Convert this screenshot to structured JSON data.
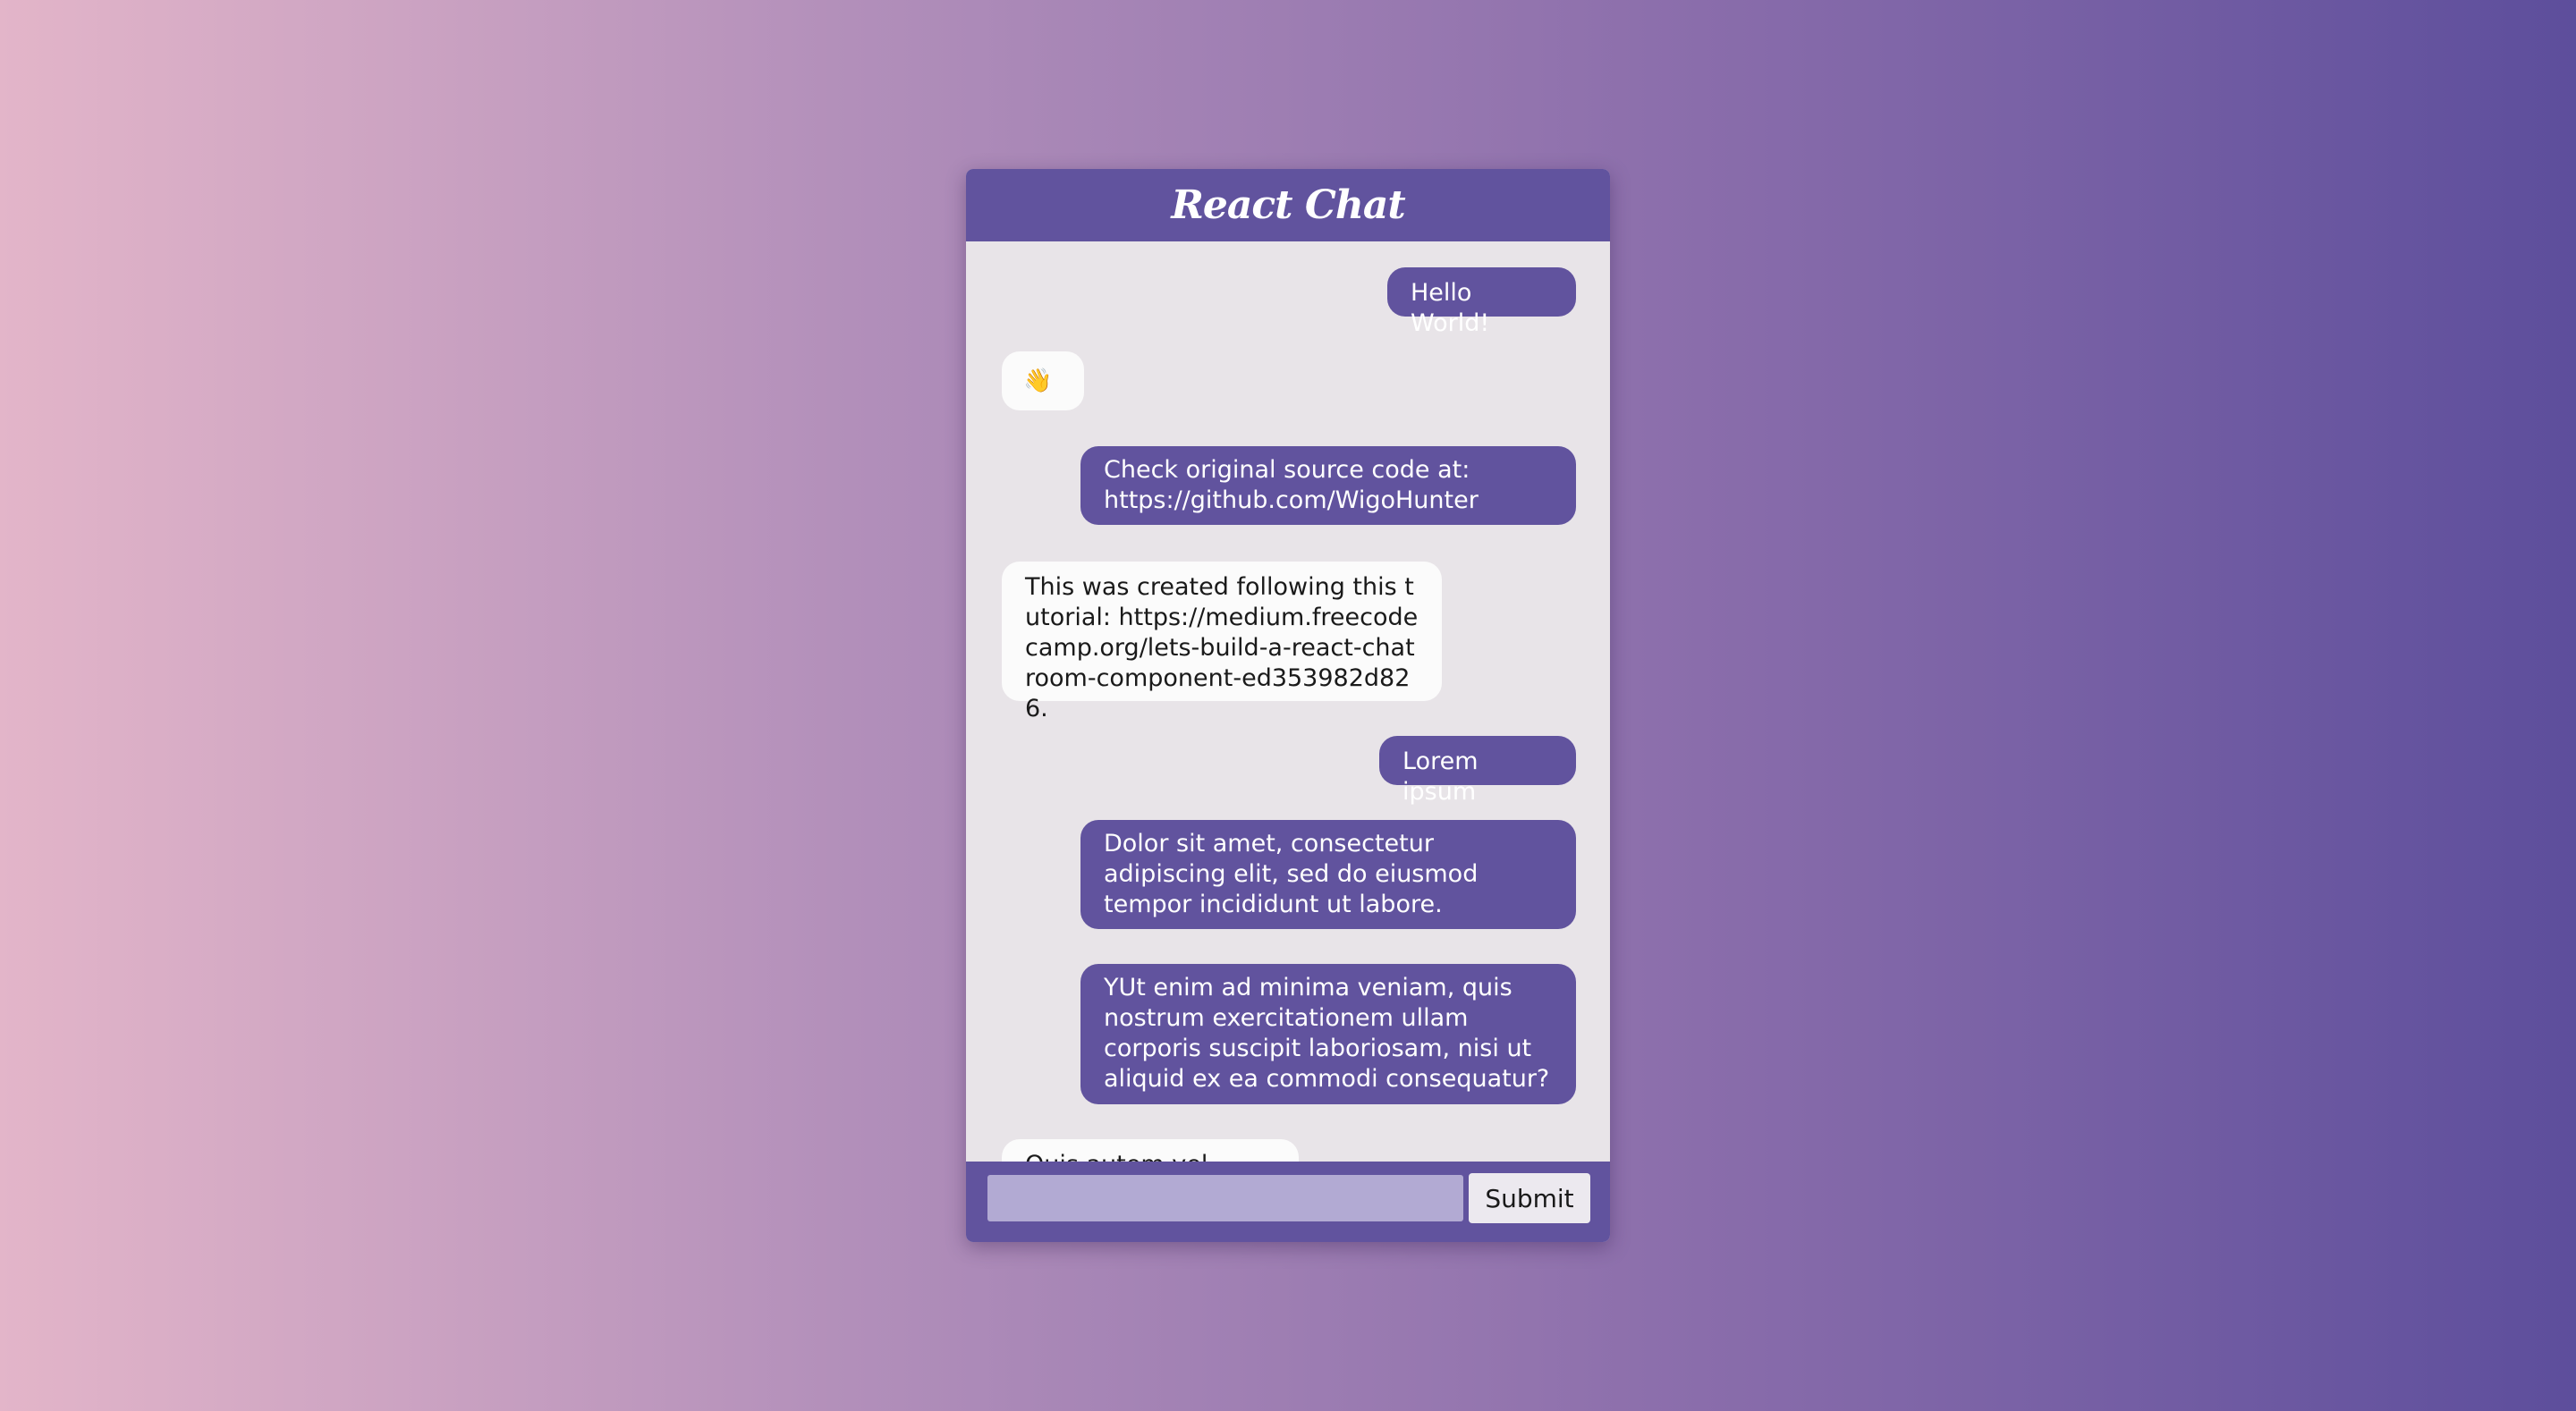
{
  "header": {
    "title": "React Chat"
  },
  "colors": {
    "header_bg": "#61539e",
    "own_bubble": "#61539e",
    "other_bubble": "#fbfbfb",
    "chat_bg": "#e8e4e8",
    "input_bg": "#b2aad3"
  },
  "messages": [
    {
      "sender": "me",
      "text": "Hello World!"
    },
    {
      "sender": "other",
      "text": "👋"
    },
    {
      "sender": "me",
      "text": "Check original source code at: https://github.com/WigoHunter"
    },
    {
      "sender": "other",
      "text": "This was created following this tutorial: https://medium.freecodecamp.org/lets-build-a-react-chatroom-component-ed353982d826."
    },
    {
      "sender": "me",
      "text": "Lorem ipsum"
    },
    {
      "sender": "me",
      "text": "Dolor sit amet, consectetur adipiscing elit, sed do eiusmod tempor incididunt ut labore."
    },
    {
      "sender": "me",
      "text": "YUt enim ad minima veniam, quis nostrum exercitationem ullam corporis suscipit laboriosam, nisi ut aliquid ex ea commodi consequatur?"
    },
    {
      "sender": "other",
      "text": "Quis autem vel"
    }
  ],
  "composer": {
    "input_value": "",
    "submit_label": "Submit"
  }
}
